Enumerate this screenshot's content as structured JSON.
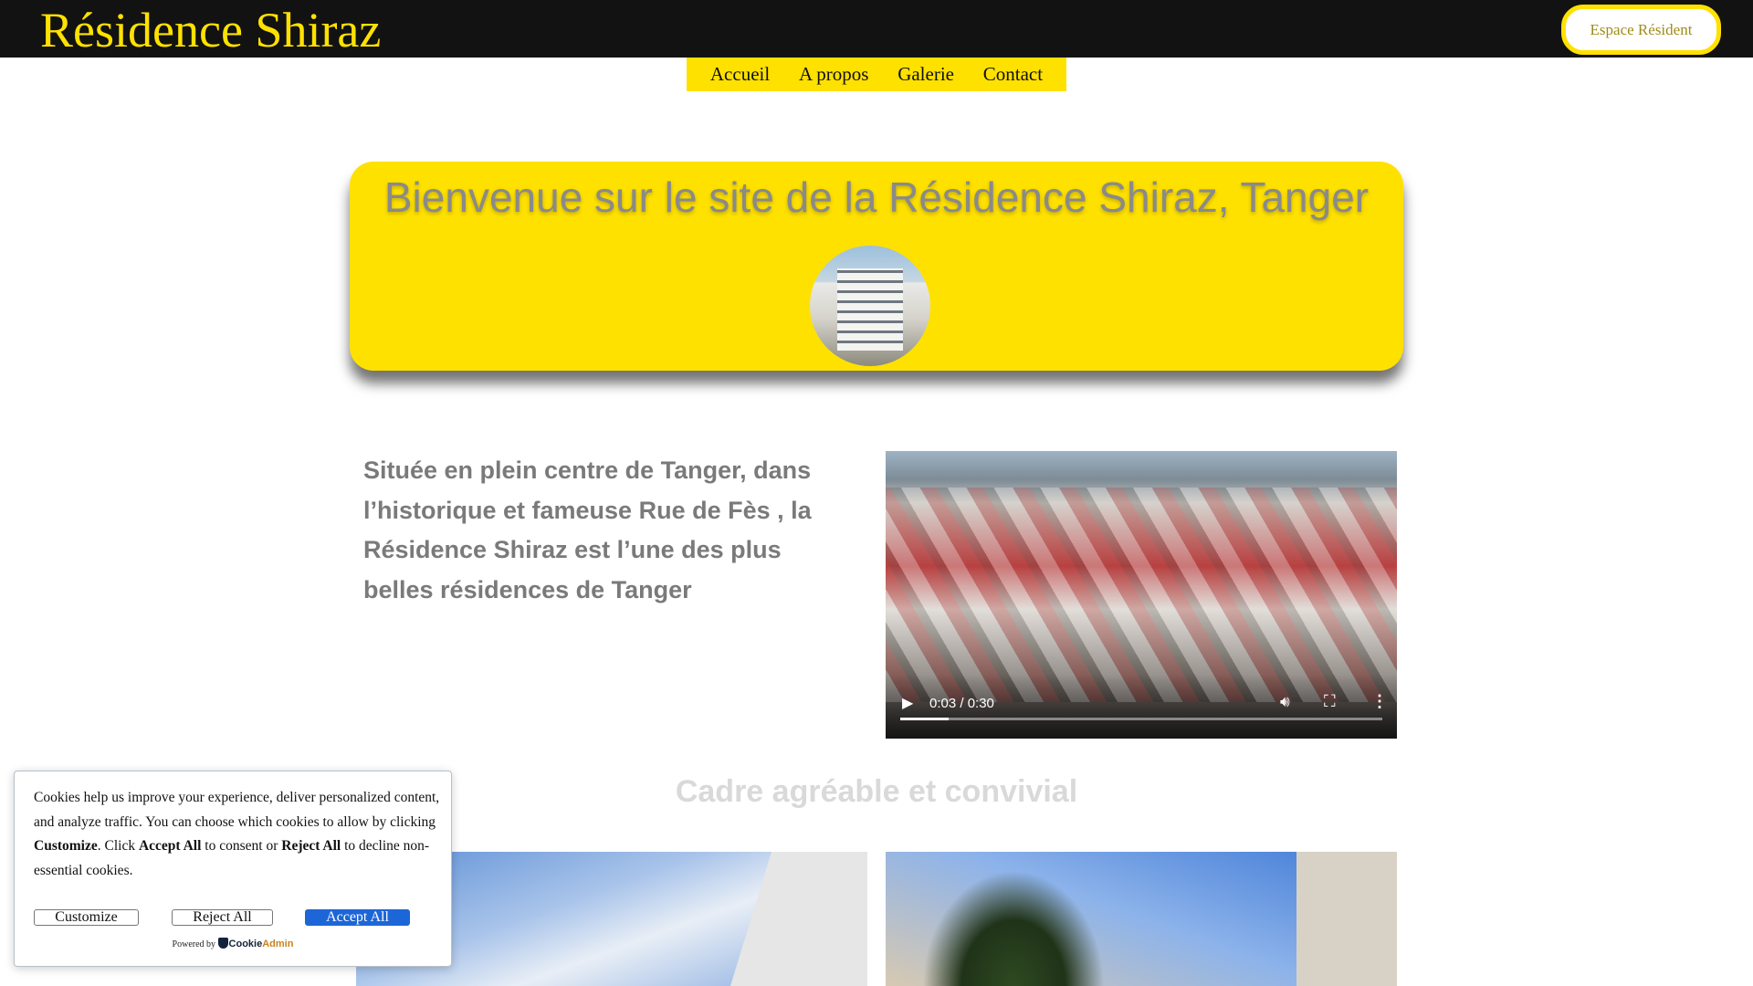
{
  "header": {
    "title": "Résidence Shiraz",
    "espace_button": "Espace Résident"
  },
  "nav": {
    "items": [
      "Accueil",
      "A propos",
      "Galerie",
      "Contact"
    ]
  },
  "hero": {
    "title": "Bienvenue sur le site de la Résidence Shiraz, Tanger"
  },
  "intro": {
    "text": "Située en plein centre de Tanger, dans l’historique et fameuse Rue de Fès , la Résidence Shiraz est l’une des plus belles résidences de Tanger"
  },
  "video": {
    "time": "0:03 / 0:30",
    "progress": 0.1
  },
  "section": {
    "heading": "Cadre agréable et convivial"
  },
  "cookie": {
    "t1": "Cookies help us improve your experience, deliver personalized content, and analyze traffic. You can choose which cookies to allow by clicking ",
    "b1": "Customize",
    "t2": ". Click ",
    "b2": "Accept All",
    "t3": " to consent or ",
    "b3": "Reject All",
    "t4": " to decline non-essential cookies.",
    "customize": "Customize",
    "reject": "Reject All",
    "accept": "Accept All",
    "powered_by": "Powered by",
    "brand_a": "Cookie",
    "brand_b": "Admin"
  }
}
